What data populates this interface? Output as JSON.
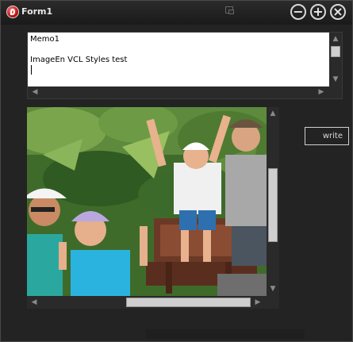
{
  "window": {
    "title": "Form1"
  },
  "memo": {
    "lines": "Memo1\n\nImageEn VCL Styles test"
  },
  "caption_buttons": {
    "minimize": "−",
    "maximize": "+",
    "close": "×"
  },
  "write_button": {
    "label": "write"
  },
  "scroll_arrows": {
    "up": "▲",
    "down": "▼",
    "left": "◀",
    "right": "▶"
  },
  "image": {
    "description_icon": "photo-family-in-jungle"
  },
  "colors": {
    "background": "#232323",
    "title_text": "#e8e8e8",
    "memo_bg": "#ffffff"
  }
}
